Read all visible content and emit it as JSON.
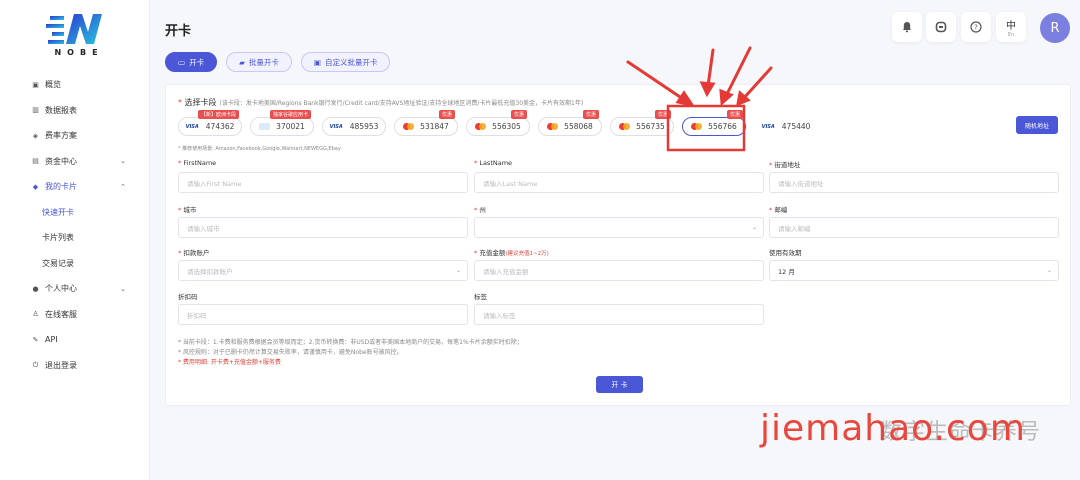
{
  "brand": {
    "name": "NOBE"
  },
  "sidebar": {
    "items": [
      {
        "label": "概览",
        "icon": "home-icon"
      },
      {
        "label": "数据报表",
        "icon": "chart-icon"
      },
      {
        "label": "费率方案",
        "icon": "diamond-icon"
      },
      {
        "label": "资金中心",
        "icon": "wallet-icon",
        "chevron": "⌄"
      },
      {
        "label": "我的卡片",
        "icon": "card-icon",
        "chevron": "⌃"
      },
      {
        "label": "快速开卡"
      },
      {
        "label": "卡片列表"
      },
      {
        "label": "交易记录"
      },
      {
        "label": "个人中心",
        "icon": "user-icon",
        "chevron": "⌄"
      },
      {
        "label": "在线客服",
        "icon": "support-icon"
      },
      {
        "label": "API",
        "icon": "api-icon"
      },
      {
        "label": "退出登录",
        "icon": "power-icon"
      }
    ]
  },
  "header": {
    "title": "开卡",
    "lang_main": "中",
    "lang_sub": "En",
    "avatar": "R"
  },
  "tabs": [
    {
      "label": "开卡"
    },
    {
      "label": "批量开卡"
    },
    {
      "label": "自定义批量开卡"
    }
  ],
  "form": {
    "segment_label": "选择卡段",
    "segment_desc": "(该卡段：发卡地美国/Regions Bank银行发行/Credit card/支持AVS地址验证/支持全球地区消费/卡片最低充值30美金，卡片有效期1年)",
    "bins": [
      {
        "number": "474362",
        "brand": "visa",
        "badge": "【新】欧洲卡段"
      },
      {
        "number": "370021",
        "brand": "amex",
        "badge": "独家谷歌应用卡"
      },
      {
        "number": "485953",
        "brand": "visa",
        "badge": ""
      },
      {
        "number": "531847",
        "brand": "mc",
        "badge": "优惠"
      },
      {
        "number": "556305",
        "brand": "mc",
        "badge": "优惠"
      },
      {
        "number": "558068",
        "brand": "mc",
        "badge": "优惠"
      },
      {
        "number": "556735",
        "brand": "mc",
        "badge": "优惠"
      },
      {
        "number": "556766",
        "brand": "mc",
        "badge": "优惠"
      },
      {
        "number": "475440",
        "brand": "visa",
        "badge": ""
      }
    ],
    "visa_text": "VISA",
    "random_address": "随机地址",
    "usage": "* 推荐使用场景: Amazon,Facebook,Google,Walmart,NEWEGG,Ebay",
    "fields": {
      "firstname": {
        "label": "FirstName",
        "placeholder": "请输入First Name"
      },
      "lastname": {
        "label": "LastName",
        "placeholder": "请输入Last Name"
      },
      "street": {
        "label": "街道地址",
        "placeholder": "请输入街道地址"
      },
      "city": {
        "label": "城市",
        "placeholder": "请输入城市"
      },
      "state": {
        "label": "州",
        "placeholder": ""
      },
      "zip": {
        "label": "邮编",
        "placeholder": "请输入邮编"
      },
      "debit": {
        "label": "扣款账户",
        "placeholder": "请选择扣款账户"
      },
      "amount": {
        "label": "充值金额",
        "hint": "(建议充值1~2万)",
        "placeholder": "请输入充值金额"
      },
      "validity": {
        "label": "使用有效期",
        "value": "12 月"
      },
      "discount": {
        "label": "折扣码",
        "placeholder": "折扣码"
      },
      "tag": {
        "label": "标签",
        "placeholder": "请输入标签"
      }
    },
    "notes": [
      "* 当前卡段：1.卡费和服务费根据会员等级而定；2.货币转换费：非USD或者非美国本地商户的交易，每笔1%卡片余额实时扣除；",
      "* 风控规则：对于已删卡仍然计算交易失败率，请谨慎用卡，避免Nobe账号被风控。",
      "* 费用明细: 开卡费+充值金额+服务费"
    ],
    "submit": "开 卡"
  },
  "watermark": {
    "main": "jiemahao.com",
    "sub": "数字生命卡养号"
  },
  "colors": {
    "accent": "#4a57d6",
    "badge": "#e94f4f",
    "annotation": "#e53935",
    "watermark": "#e8473d"
  }
}
